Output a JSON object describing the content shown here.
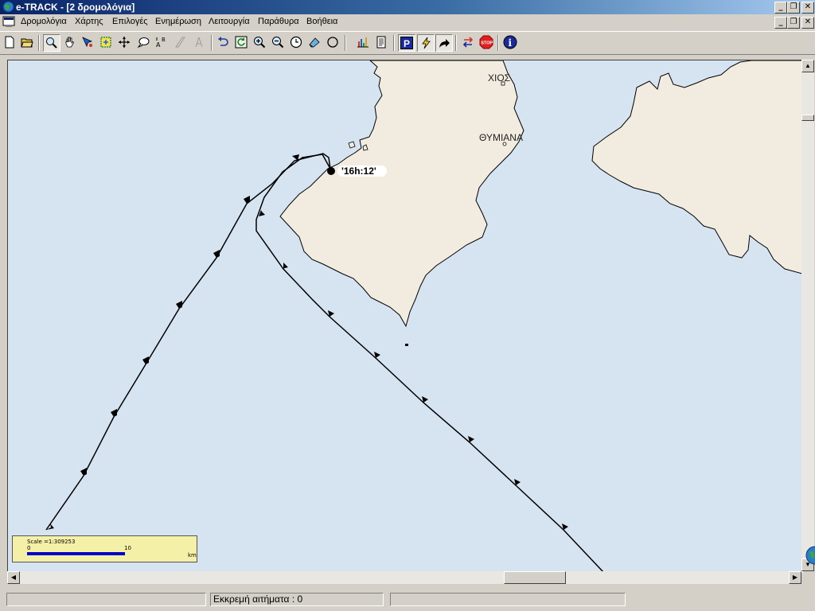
{
  "window": {
    "title": "e-TRACK - [2 δρομολόγια]",
    "minimize": "_",
    "restore": "❐",
    "close": "✕"
  },
  "menu": {
    "items": [
      "Δρομολόγια",
      "Χάρτης",
      "Επιλογές",
      "Ενημέρωση",
      "Λειτουργία",
      "Παράθυρα",
      "Βοήθεια"
    ]
  },
  "toolbar": {
    "icons": [
      "new-icon",
      "open-icon",
      "zoom-select-icon",
      "pan-hand-icon",
      "pointer-icon",
      "grid-select-icon",
      "crosshair-icon",
      "callout-icon",
      "label-ab-icon",
      "ruler-icon",
      "measure-icon",
      "undo-icon",
      "refresh-icon",
      "zoom-in-icon",
      "zoom-out-icon",
      "clock-icon",
      "eraser-icon",
      "circle-icon",
      "chart-icon",
      "report-icon",
      "parking-icon",
      "lightning-icon",
      "forward-arrow-icon",
      "swap-arrows-icon",
      "stop-icon",
      "info-icon"
    ],
    "parking_label": "P",
    "stop_label": "STOP",
    "info_label": "i"
  },
  "map": {
    "places": [
      {
        "name": "ΧΙΟΣ"
      },
      {
        "name": "ΘΥΜΙΑΝΑ"
      }
    ],
    "time_marker": "'16h:12'",
    "colors": {
      "sea": "#d6e4f2",
      "land": "#f2ece0",
      "track": "#000000"
    }
  },
  "scale": {
    "title": "Scale =1:309253",
    "zero": "0",
    "ten": "10",
    "unit": "km"
  },
  "status": {
    "pending_requests": "Εκκρεμή αιτήματα : 0"
  }
}
